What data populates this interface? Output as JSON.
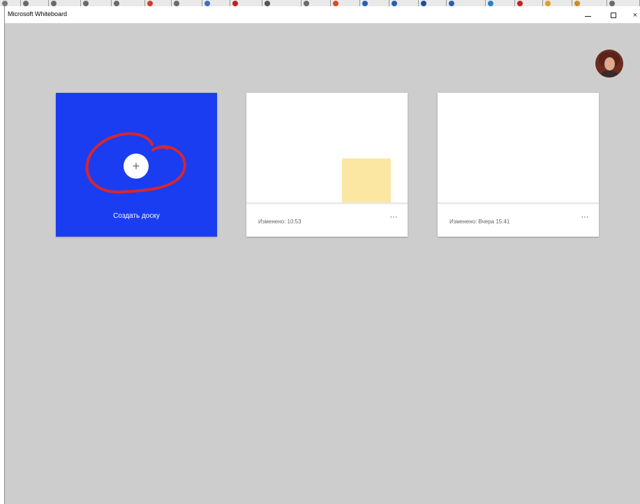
{
  "window": {
    "title": "Microsoft Whiteboard",
    "minimize_icon": "minimize-icon",
    "maximize_icon": "maximize-icon",
    "close_icon": "close-icon",
    "close_glyph": "×"
  },
  "account": {
    "avatar_icon": "user-avatar"
  },
  "create_board": {
    "plus_glyph": "+",
    "label": "Создать доску",
    "background_color": "#1a3df2",
    "annotation_color": "#d9262a"
  },
  "boards": [
    {
      "modified": "Изменено: 10:53",
      "more_glyph": "···",
      "thumbnail": "sticky-note",
      "sticky_color": "#fbe7a1"
    },
    {
      "modified": "Изменено: Вчера 15:41",
      "more_glyph": "···",
      "thumbnail": "empty"
    }
  ],
  "colors": {
    "canvas_background": "#cdcdcd",
    "accent": "#1a3df2"
  }
}
